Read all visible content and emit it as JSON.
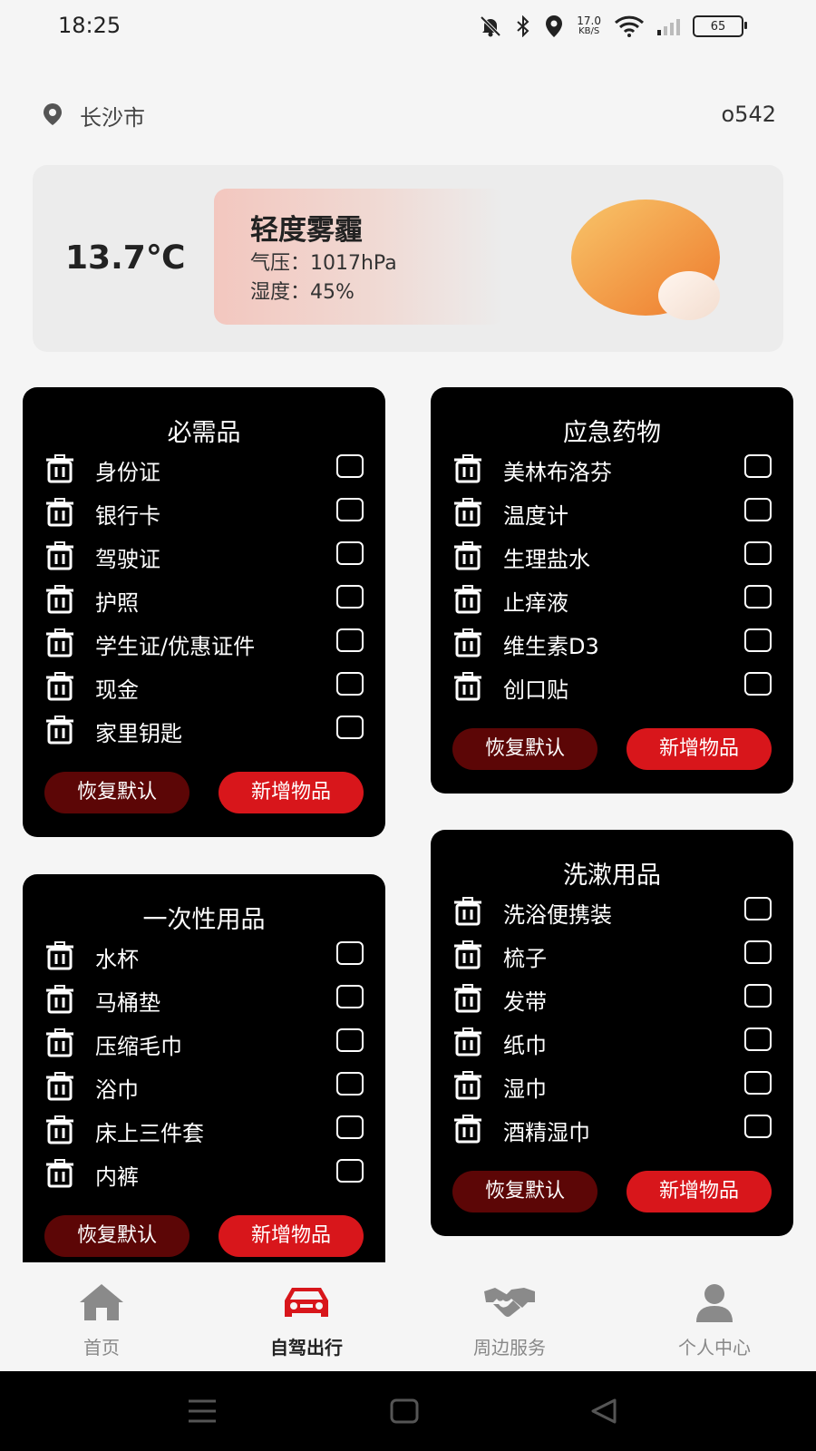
{
  "status_bar": {
    "time": "18:25",
    "net_speed_value": "17.0",
    "net_speed_unit": "KB/S",
    "battery": "65"
  },
  "location": {
    "city": "长沙市",
    "user_code": "o542"
  },
  "weather": {
    "temperature": "13.7℃",
    "condition": "轻度雾霾",
    "pressure": "气压：1017hPa",
    "humidity": "湿度：45%"
  },
  "cards": [
    {
      "title": "必需品",
      "items": [
        "身份证",
        "银行卡",
        "驾驶证",
        "护照",
        "学生证/优惠证件",
        "现金",
        "家里钥匙"
      ],
      "reset_label": "恢复默认",
      "add_label": "新增物品"
    },
    {
      "title": "应急药物",
      "items": [
        "美林布洛芬",
        "温度计",
        "生理盐水",
        "止痒液",
        "维生素D3",
        "创口贴"
      ],
      "reset_label": "恢复默认",
      "add_label": "新增物品"
    },
    {
      "title": "一次性用品",
      "items": [
        "水杯",
        "马桶垫",
        "压缩毛巾",
        "浴巾",
        "床上三件套",
        "内裤"
      ],
      "reset_label": "恢复默认",
      "add_label": "新增物品"
    },
    {
      "title": "洗漱用品",
      "items": [
        "洗浴便携装",
        "梳子",
        "发带",
        "纸巾",
        "湿巾",
        "酒精湿巾"
      ],
      "reset_label": "恢复默认",
      "add_label": "新增物品"
    }
  ],
  "bottom_nav": [
    {
      "label": "首页",
      "icon": "home-icon",
      "active": false
    },
    {
      "label": "自驾出行",
      "icon": "car-icon",
      "active": true
    },
    {
      "label": "周边服务",
      "icon": "handshake-icon",
      "active": false
    },
    {
      "label": "个人中心",
      "icon": "user-icon",
      "active": false
    }
  ],
  "colors": {
    "accent_red": "#d8161b",
    "dark_red": "#5c0606",
    "card_bg": "#000000",
    "page_bg": "#f5f5f5"
  }
}
